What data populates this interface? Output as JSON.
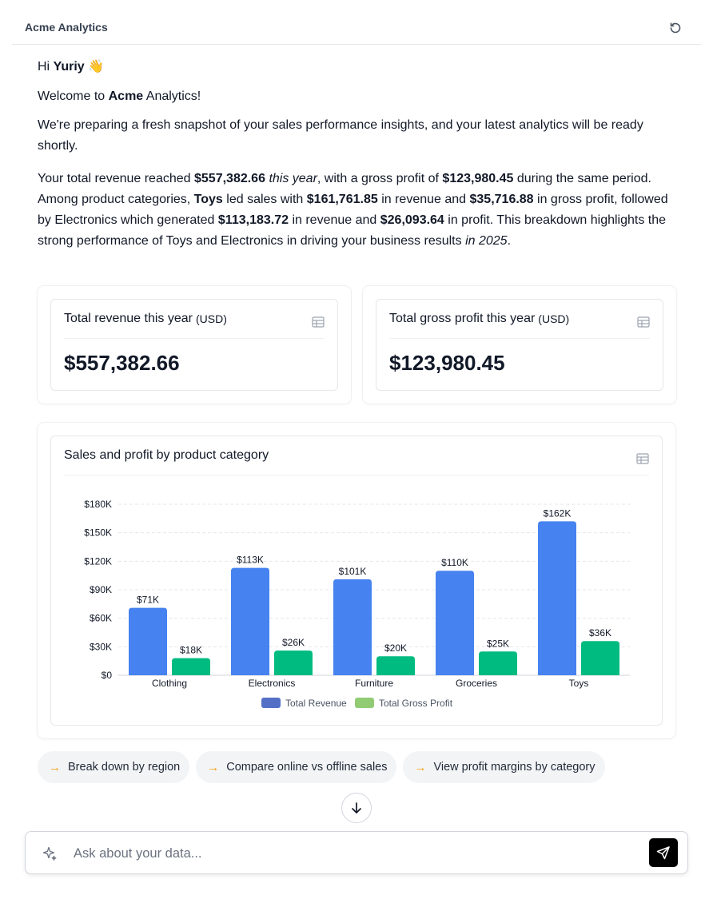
{
  "header": {
    "title": "Acme Analytics"
  },
  "message": {
    "greeting_prefix": "Hi ",
    "user_name": "Yuriy",
    "wave": "👋",
    "welcome_prefix": "Welcome to ",
    "welcome_brand": "Acme",
    "welcome_suffix": " Analytics!",
    "preparing": "We're preparing a fresh snapshot of your sales performance insights, and your latest analytics will be ready shortly.",
    "summary": {
      "t1": "Your total revenue reached ",
      "revenue": "$557,382.66",
      "t2": " ",
      "this_year": "this year",
      "t3": ", with a gross profit of ",
      "profit": "$123,980.45",
      "t4": " during the same period. Among product categories, ",
      "top_category": "Toys",
      "t5": " led sales with ",
      "toys_revenue": "$161,761.85",
      "t6": " in revenue and ",
      "toys_profit": "$35,716.88",
      "t7": " in gross profit, followed by Electronics which generated ",
      "elec_revenue": "$113,183.72",
      "t8": " in revenue and ",
      "elec_profit": "$26,093.64",
      "t9": " in profit. This breakdown highlights the strong performance of Toys and Electronics in driving your business results ",
      "in_2025": "in 2025",
      "t10": "."
    }
  },
  "kpis": [
    {
      "title": "Total revenue this year",
      "unit": "(USD)",
      "value": "$557,382.66"
    },
    {
      "title": "Total gross profit this year",
      "unit": "(USD)",
      "value": "$123,980.45"
    }
  ],
  "chart_card": {
    "title": "Sales and profit by product category"
  },
  "chart_data": {
    "type": "bar",
    "categories": [
      "Clothing",
      "Electronics",
      "Furniture",
      "Groceries",
      "Toys"
    ],
    "series": [
      {
        "name": "Total Revenue",
        "values": [
          71000,
          113000,
          101000,
          110000,
          162000
        ],
        "labels": [
          "$71K",
          "$113K",
          "$101K",
          "$110K",
          "$162K"
        ],
        "color": "#4682f0",
        "legend_color": "#5470c6"
      },
      {
        "name": "Total Gross Profit",
        "values": [
          18000,
          26000,
          20000,
          25000,
          36000
        ],
        "labels": [
          "$18K",
          "$26K",
          "$20K",
          "$25K",
          "$36K"
        ],
        "color": "#00bb7f",
        "legend_color": "#91cc75"
      }
    ],
    "y_ticks": [
      0,
      30000,
      60000,
      90000,
      120000,
      150000,
      180000
    ],
    "y_tick_labels": [
      "$0",
      "$30K",
      "$60K",
      "$90K",
      "$120K",
      "$150K",
      "$180K"
    ],
    "ylim": [
      0,
      180000
    ],
    "grid": true,
    "legend": "bottom-center"
  },
  "suggestions": [
    {
      "arrow": "→",
      "label": "Break down by region"
    },
    {
      "arrow": "→",
      "label": "Compare online vs offline sales"
    },
    {
      "arrow": "→",
      "label": "View profit margins by category"
    }
  ],
  "composer": {
    "placeholder": "Ask about your data..."
  }
}
